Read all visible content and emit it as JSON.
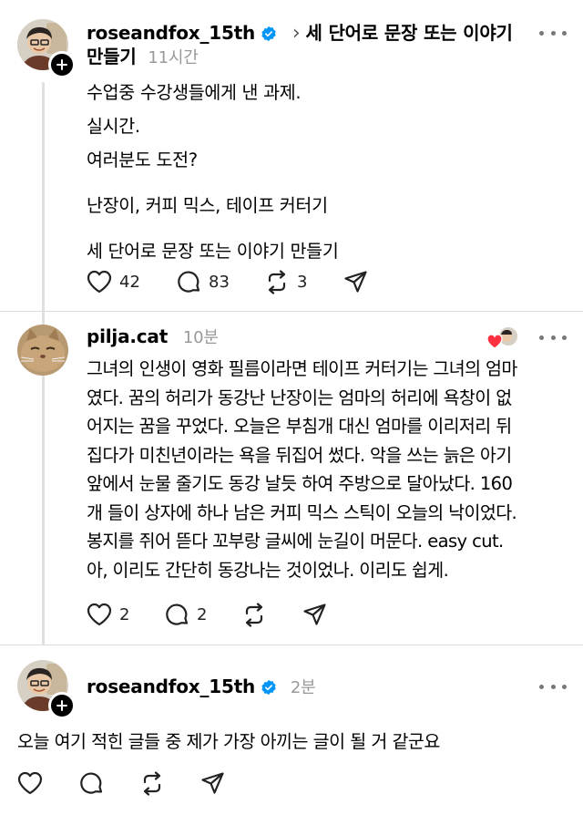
{
  "posts": [
    {
      "username": "roseandfox_15th",
      "topic_chevron": "›",
      "topic": "세 단어로 문장 또는 이야기",
      "topic_cont": "만들기",
      "time": "11시간",
      "lines": [
        "수업중 수강생들에게 낸 과제.",
        "실시간.",
        "여러분도 도전?",
        "난장이, 커피 믹스, 테이프 커터기",
        "세 단어로 문장 또는 이야기 만들기"
      ],
      "likes": "42",
      "replies": "83",
      "reposts": "3"
    },
    {
      "username": "pilja.cat",
      "time": "10분",
      "lines": [
        "그녀의 인생이 영화 필름이라면 테이프 커터기는 그녀의 엄마",
        "였다. 꿈의 허리가 동강난 난장이는 엄마의 허리에 욕창이 없",
        "어지는 꿈을 꾸었다. 오늘은 부침개 대신 엄마를 이리저리 뒤",
        "집다가 미친년이라는 욕을 뒤집어 썼다. 악을 쓰는 늙은 아기",
        "앞에서 눈물 줄기도 동강 날듯 하여 주방으로 달아났다. 160",
        "개 들이 상자에 하나 남은 커피 믹스 스틱이 오늘의 낙이었다.",
        "봉지를 쥐어 뜯다 꼬부랑 글씨에 눈길이 머문다. easy cut.",
        "아, 이리도 간단히 동강나는 것이었나. 이리도 쉽게."
      ],
      "likes": "2",
      "replies": "2"
    },
    {
      "username": "roseandfox_15th",
      "time": "2분",
      "lines": [
        "오늘 여기 적힌 글들 중 제가 가장 아끼는 글이 될 거 같군요"
      ]
    }
  ],
  "colors": {
    "verified": "#0095f6",
    "heart": "#ff3040",
    "muted": "#999999",
    "thread_line": "#e0e0e0"
  }
}
